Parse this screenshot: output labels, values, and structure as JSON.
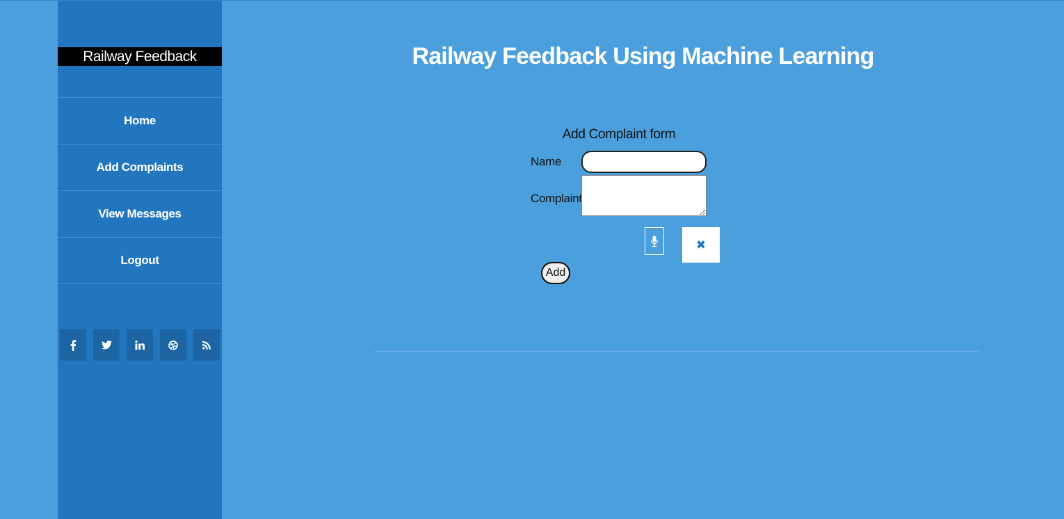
{
  "sidebar": {
    "brand": "Railway Feedback",
    "nav": [
      {
        "label": "Home"
      },
      {
        "label": "Add Complaints"
      },
      {
        "label": "View Messages"
      },
      {
        "label": "Logout"
      }
    ],
    "social": [
      {
        "icon": "facebook-icon",
        "glyph": "f"
      },
      {
        "icon": "twitter-icon",
        "glyph": "🐦"
      },
      {
        "icon": "linkedin-icon",
        "glyph": "in"
      },
      {
        "icon": "dribbble-icon",
        "glyph": "⊛"
      },
      {
        "icon": "rss-icon",
        "glyph": "))"
      }
    ]
  },
  "main": {
    "title": "Railway Feedback Using Machine Learning"
  },
  "form": {
    "title": "Add Complaint form",
    "name_label": "Name",
    "name_value": "",
    "complaint_label": "Complaint",
    "complaint_value": "",
    "mic_icon": "microphone-icon",
    "clear_glyph": "✖",
    "clear_icon": "close-icon",
    "add_label": "Add"
  },
  "colors": {
    "background": "#4a9fdc",
    "sidebar": "#2176be",
    "social_tile": "#1d64a3"
  }
}
